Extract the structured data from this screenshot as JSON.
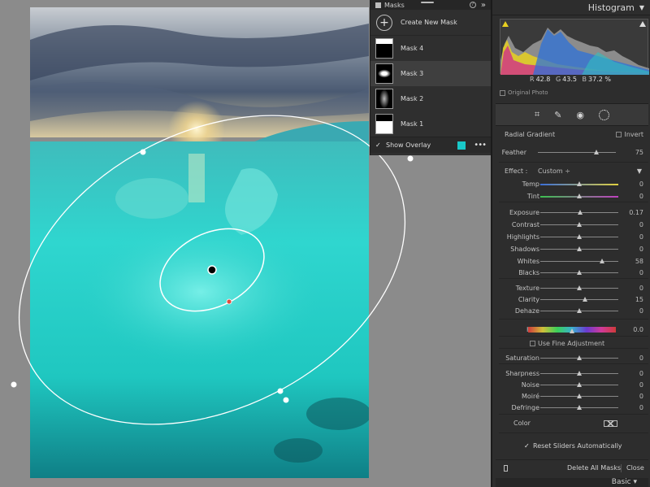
{
  "masks_panel": {
    "title": "Masks",
    "help": "?",
    "collapse": "»",
    "create_label": "Create New Mask",
    "masks": [
      {
        "name": "Mask 4",
        "selected": false
      },
      {
        "name": "Mask 3",
        "selected": true
      },
      {
        "name": "Mask 2",
        "selected": false
      },
      {
        "name": "Mask 1",
        "selected": false
      }
    ],
    "show_overlay_label": "Show Overlay",
    "show_overlay_checked": true,
    "overlay_color": "#19c8c8",
    "more": "•••"
  },
  "histogram": {
    "title": "Histogram",
    "r_label": "R",
    "r_value": "42.8",
    "g_label": "G",
    "g_value": "43.5",
    "b_label": "B",
    "b_value": "37.2 %",
    "original_photo_label": "Original Photo"
  },
  "tools": [
    "crop-icon",
    "healing-icon",
    "red-eye-icon",
    "masking-icon"
  ],
  "mask_settings": {
    "type_label": "Radial Gradient",
    "invert_label": "Invert",
    "feather_label": "Feather",
    "feather_value": "75",
    "feather_pos": 0.75,
    "effect_label": "Effect :",
    "effect_value": "Custom ÷",
    "sliders": [
      {
        "name": "Temp",
        "value": "0",
        "pos": 0.5,
        "color": "temp"
      },
      {
        "name": "Tint",
        "value": "0",
        "pos": 0.5,
        "color": "tint"
      },
      {
        "name": "Exposure",
        "value": "0.17",
        "pos": 0.51
      },
      {
        "name": "Contrast",
        "value": "0",
        "pos": 0.5
      },
      {
        "name": "Highlights",
        "value": "0",
        "pos": 0.5
      },
      {
        "name": "Shadows",
        "value": "0",
        "pos": 0.5
      },
      {
        "name": "Whites",
        "value": "58",
        "pos": 0.79
      },
      {
        "name": "Blacks",
        "value": "0",
        "pos": 0.5
      },
      {
        "name": "Texture",
        "value": "0",
        "pos": 0.5
      },
      {
        "name": "Clarity",
        "value": "15",
        "pos": 0.575
      },
      {
        "name": "Dehaze",
        "value": "0",
        "pos": 0.5
      },
      {
        "name": "Hue",
        "value": "0.0",
        "pos": 0.5,
        "color": "hue"
      },
      {
        "name": "Saturation",
        "value": "0",
        "pos": 0.5
      },
      {
        "name": "Sharpness",
        "value": "0",
        "pos": 0.5
      },
      {
        "name": "Noise",
        "value": "0",
        "pos": 0.5
      },
      {
        "name": "Moiré",
        "value": "0",
        "pos": 0.5
      },
      {
        "name": "Defringe",
        "value": "0",
        "pos": 0.5
      }
    ],
    "fine_adjustment_label": "Use Fine Adjustment",
    "color_label": "Color",
    "reset_label": "Reset Sliders Automatically",
    "reset_checked": true
  },
  "footer": {
    "delete_all_label": "Delete All Masks",
    "close_label": "Close",
    "basic_label": "Basic ▾"
  }
}
